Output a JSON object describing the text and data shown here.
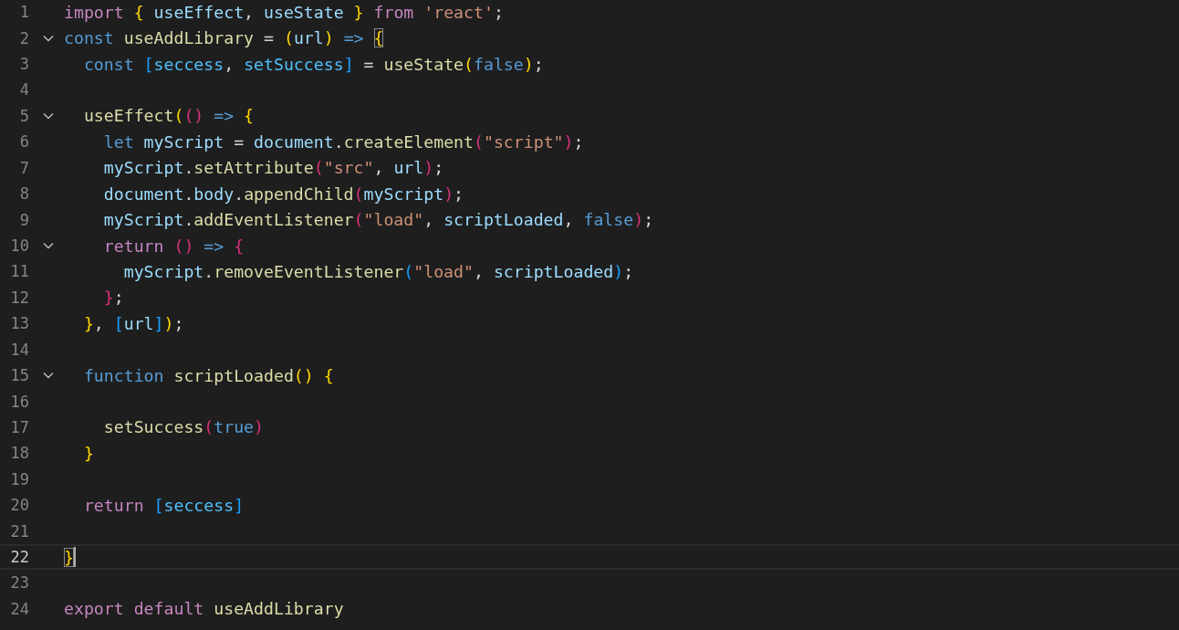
{
  "editor": {
    "lines": [
      {
        "number": "1",
        "foldable": false,
        "selected": false,
        "tokens": [
          {
            "kind": "control",
            "text": "import"
          },
          {
            "kind": "gold",
            "text": " {"
          },
          {
            "kind": "variable",
            "text": " useEffect"
          },
          {
            "kind": "plain",
            "text": ", "
          },
          {
            "kind": "variable",
            "text": "useState"
          },
          {
            "kind": "gold",
            "text": " }"
          },
          {
            "kind": "control",
            "text": " from"
          },
          {
            "kind": "string",
            "text": " 'react'"
          },
          {
            "kind": "plain",
            "text": ";"
          }
        ]
      },
      {
        "number": "2",
        "foldable": true,
        "selected": false,
        "tokens": [
          {
            "kind": "storage",
            "text": "const"
          },
          {
            "kind": "function",
            "text": " useAddLibrary"
          },
          {
            "kind": "plain",
            "text": " = "
          },
          {
            "kind": "gold",
            "text": "("
          },
          {
            "kind": "variable",
            "text": "url"
          },
          {
            "kind": "gold",
            "text": ")"
          },
          {
            "kind": "storage",
            "text": " =>"
          },
          {
            "kind": "match",
            "text": " {"
          }
        ]
      },
      {
        "number": "3",
        "foldable": false,
        "selected": false,
        "tokens": [
          {
            "kind": "storage",
            "text": "  const"
          },
          {
            "kind": "blue",
            "text": " ["
          },
          {
            "kind": "constant",
            "text": "seccess"
          },
          {
            "kind": "plain",
            "text": ", "
          },
          {
            "kind": "constant",
            "text": "setSuccess"
          },
          {
            "kind": "blue",
            "text": "]"
          },
          {
            "kind": "plain",
            "text": " = "
          },
          {
            "kind": "function",
            "text": "useState"
          },
          {
            "kind": "gold",
            "text": "("
          },
          {
            "kind": "storage",
            "text": "false"
          },
          {
            "kind": "gold",
            "text": ")"
          },
          {
            "kind": "plain",
            "text": ";"
          }
        ]
      },
      {
        "number": "4",
        "foldable": false,
        "selected": false
      },
      {
        "number": "5",
        "foldable": true,
        "selected": false,
        "tokens": [
          {
            "kind": "function",
            "text": "  useEffect"
          },
          {
            "kind": "gold",
            "text": "("
          },
          {
            "kind": "crimson",
            "text": "()"
          },
          {
            "kind": "storage",
            "text": " =>"
          },
          {
            "kind": "gold",
            "text": " {"
          }
        ]
      },
      {
        "number": "6",
        "foldable": false,
        "selected": false,
        "tokens": [
          {
            "kind": "storage",
            "text": "    let"
          },
          {
            "kind": "variable",
            "text": " myScript"
          },
          {
            "kind": "plain",
            "text": " = "
          },
          {
            "kind": "variable",
            "text": "document"
          },
          {
            "kind": "plain",
            "text": "."
          },
          {
            "kind": "function",
            "text": "createElement"
          },
          {
            "kind": "crimson",
            "text": "("
          },
          {
            "kind": "string",
            "text": "\"script\""
          },
          {
            "kind": "crimson",
            "text": ")"
          },
          {
            "kind": "plain",
            "text": ";"
          }
        ]
      },
      {
        "number": "7",
        "foldable": false,
        "selected": false,
        "tokens": [
          {
            "kind": "variable",
            "text": "    myScript"
          },
          {
            "kind": "plain",
            "text": "."
          },
          {
            "kind": "function",
            "text": "setAttribute"
          },
          {
            "kind": "crimson",
            "text": "("
          },
          {
            "kind": "string",
            "text": "\"src\""
          },
          {
            "kind": "plain",
            "text": ", "
          },
          {
            "kind": "variable",
            "text": "url"
          },
          {
            "kind": "crimson",
            "text": ")"
          },
          {
            "kind": "plain",
            "text": ";"
          }
        ]
      },
      {
        "number": "8",
        "foldable": false,
        "selected": false,
        "tokens": [
          {
            "kind": "variable",
            "text": "    document"
          },
          {
            "kind": "plain",
            "text": "."
          },
          {
            "kind": "variable",
            "text": "body"
          },
          {
            "kind": "plain",
            "text": "."
          },
          {
            "kind": "function",
            "text": "appendChild"
          },
          {
            "kind": "crimson",
            "text": "("
          },
          {
            "kind": "variable",
            "text": "myScript"
          },
          {
            "kind": "crimson",
            "text": ")"
          },
          {
            "kind": "plain",
            "text": ";"
          }
        ]
      },
      {
        "number": "9",
        "foldable": false,
        "selected": false,
        "tokens": [
          {
            "kind": "variable",
            "text": "    myScript"
          },
          {
            "kind": "plain",
            "text": "."
          },
          {
            "kind": "function",
            "text": "addEventListener"
          },
          {
            "kind": "crimson",
            "text": "("
          },
          {
            "kind": "string",
            "text": "\"load\""
          },
          {
            "kind": "plain",
            "text": ", "
          },
          {
            "kind": "variable",
            "text": "scriptLoaded"
          },
          {
            "kind": "plain",
            "text": ", "
          },
          {
            "kind": "storage",
            "text": "false"
          },
          {
            "kind": "crimson",
            "text": ")"
          },
          {
            "kind": "plain",
            "text": ";"
          }
        ]
      },
      {
        "number": "10",
        "foldable": true,
        "selected": false,
        "tokens": [
          {
            "kind": "control",
            "text": "    return"
          },
          {
            "kind": "crimson",
            "text": " ()"
          },
          {
            "kind": "storage",
            "text": " =>"
          },
          {
            "kind": "crimson",
            "text": " {"
          }
        ]
      },
      {
        "number": "11",
        "foldable": false,
        "selected": false,
        "tokens": [
          {
            "kind": "variable",
            "text": "      myScript"
          },
          {
            "kind": "plain",
            "text": "."
          },
          {
            "kind": "function",
            "text": "removeEventListener"
          },
          {
            "kind": "blue",
            "text": "("
          },
          {
            "kind": "string",
            "text": "\"load\""
          },
          {
            "kind": "plain",
            "text": ", "
          },
          {
            "kind": "variable",
            "text": "scriptLoaded"
          },
          {
            "kind": "blue",
            "text": ")"
          },
          {
            "kind": "plain",
            "text": ";"
          }
        ]
      },
      {
        "number": "12",
        "foldable": false,
        "selected": false,
        "tokens": [
          {
            "kind": "crimson",
            "text": "    }"
          },
          {
            "kind": "plain",
            "text": ";"
          }
        ]
      },
      {
        "number": "13",
        "foldable": false,
        "selected": false,
        "tokens": [
          {
            "kind": "gold",
            "text": "  }"
          },
          {
            "kind": "plain",
            "text": ", "
          },
          {
            "kind": "blue",
            "text": "["
          },
          {
            "kind": "variable",
            "text": "url"
          },
          {
            "kind": "blue",
            "text": "]"
          },
          {
            "kind": "gold",
            "text": ")"
          },
          {
            "kind": "plain",
            "text": ";"
          }
        ]
      },
      {
        "number": "14",
        "foldable": false,
        "selected": false
      },
      {
        "number": "15",
        "foldable": true,
        "selected": false,
        "tokens": [
          {
            "kind": "storage",
            "text": "  function"
          },
          {
            "kind": "function",
            "text": " scriptLoaded"
          },
          {
            "kind": "gold",
            "text": "()"
          },
          {
            "kind": "gold",
            "text": " {"
          }
        ]
      },
      {
        "number": "16",
        "foldable": false,
        "selected": false
      },
      {
        "number": "17",
        "foldable": false,
        "selected": false,
        "tokens": [
          {
            "kind": "function",
            "text": "    setSuccess"
          },
          {
            "kind": "crimson",
            "text": "("
          },
          {
            "kind": "storage",
            "text": "true"
          },
          {
            "kind": "crimson",
            "text": ")"
          }
        ]
      },
      {
        "number": "18",
        "foldable": false,
        "selected": false,
        "tokens": [
          {
            "kind": "gold",
            "text": "  }"
          }
        ]
      },
      {
        "number": "19",
        "foldable": false,
        "selected": false
      },
      {
        "number": "20",
        "foldable": false,
        "selected": false,
        "tokens": [
          {
            "kind": "control",
            "text": "  return"
          },
          {
            "kind": "blue",
            "text": " ["
          },
          {
            "kind": "constant",
            "text": "seccess"
          },
          {
            "kind": "blue",
            "text": "]"
          }
        ]
      },
      {
        "number": "21",
        "foldable": false,
        "selected": false
      },
      {
        "number": "22",
        "foldable": false,
        "selected": true,
        "tokens": [
          {
            "kind": "match",
            "text": "}"
          }
        ]
      },
      {
        "number": "23",
        "foldable": false,
        "selected": false
      },
      {
        "number": "24",
        "foldable": false,
        "selected": false,
        "tokens": [
          {
            "kind": "control",
            "text": "export"
          },
          {
            "kind": "control",
            "text": " default"
          },
          {
            "kind": "function",
            "text": " useAddLibrary"
          }
        ]
      }
    ]
  }
}
